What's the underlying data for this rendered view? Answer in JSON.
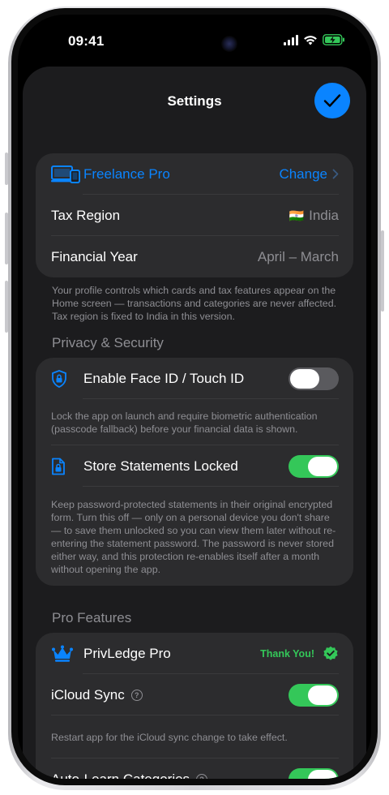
{
  "status": {
    "time": "09:41"
  },
  "header": {
    "title": "Settings"
  },
  "profile": {
    "name": "Freelance Pro",
    "change_label": "Change",
    "tax_region_label": "Tax Region",
    "tax_region_value": "India",
    "tax_region_flag": "🇮🇳",
    "fy_label": "Financial Year",
    "fy_value": "April – March",
    "footer": "Your profile controls which cards and tax features appear on the Home screen — transactions and categories are never affected. Tax region is fixed to India in this version."
  },
  "privacy": {
    "header": "Privacy & Security",
    "faceid_label": "Enable Face ID / Touch ID",
    "faceid_on": false,
    "faceid_note": "Lock the app on launch and require biometric authentication (passcode fallback) before your financial data is shown.",
    "statements_label": "Store Statements Locked",
    "statements_on": true,
    "statements_note": "Keep password-protected statements in their original encrypted form. Turn this off — only on a personal device you don't share — to save them unlocked so you can view them later without re-entering the statement password. The password is never stored either way, and this protection re-enables itself after a month without opening the app."
  },
  "pro": {
    "header": "Pro Features",
    "product_label": "PrivLedge Pro",
    "badge": "Thank You!",
    "icloud_label": "iCloud Sync",
    "icloud_on": true,
    "icloud_note": "Restart app for the iCloud sync change to take effect.",
    "autolearn_label": "Auto-Learn Categories",
    "autolearn_on": true
  },
  "colors": {
    "accent": "#0a84ff",
    "green": "#34c759",
    "background": "#1c1c1e",
    "card": "#2c2c2e"
  }
}
